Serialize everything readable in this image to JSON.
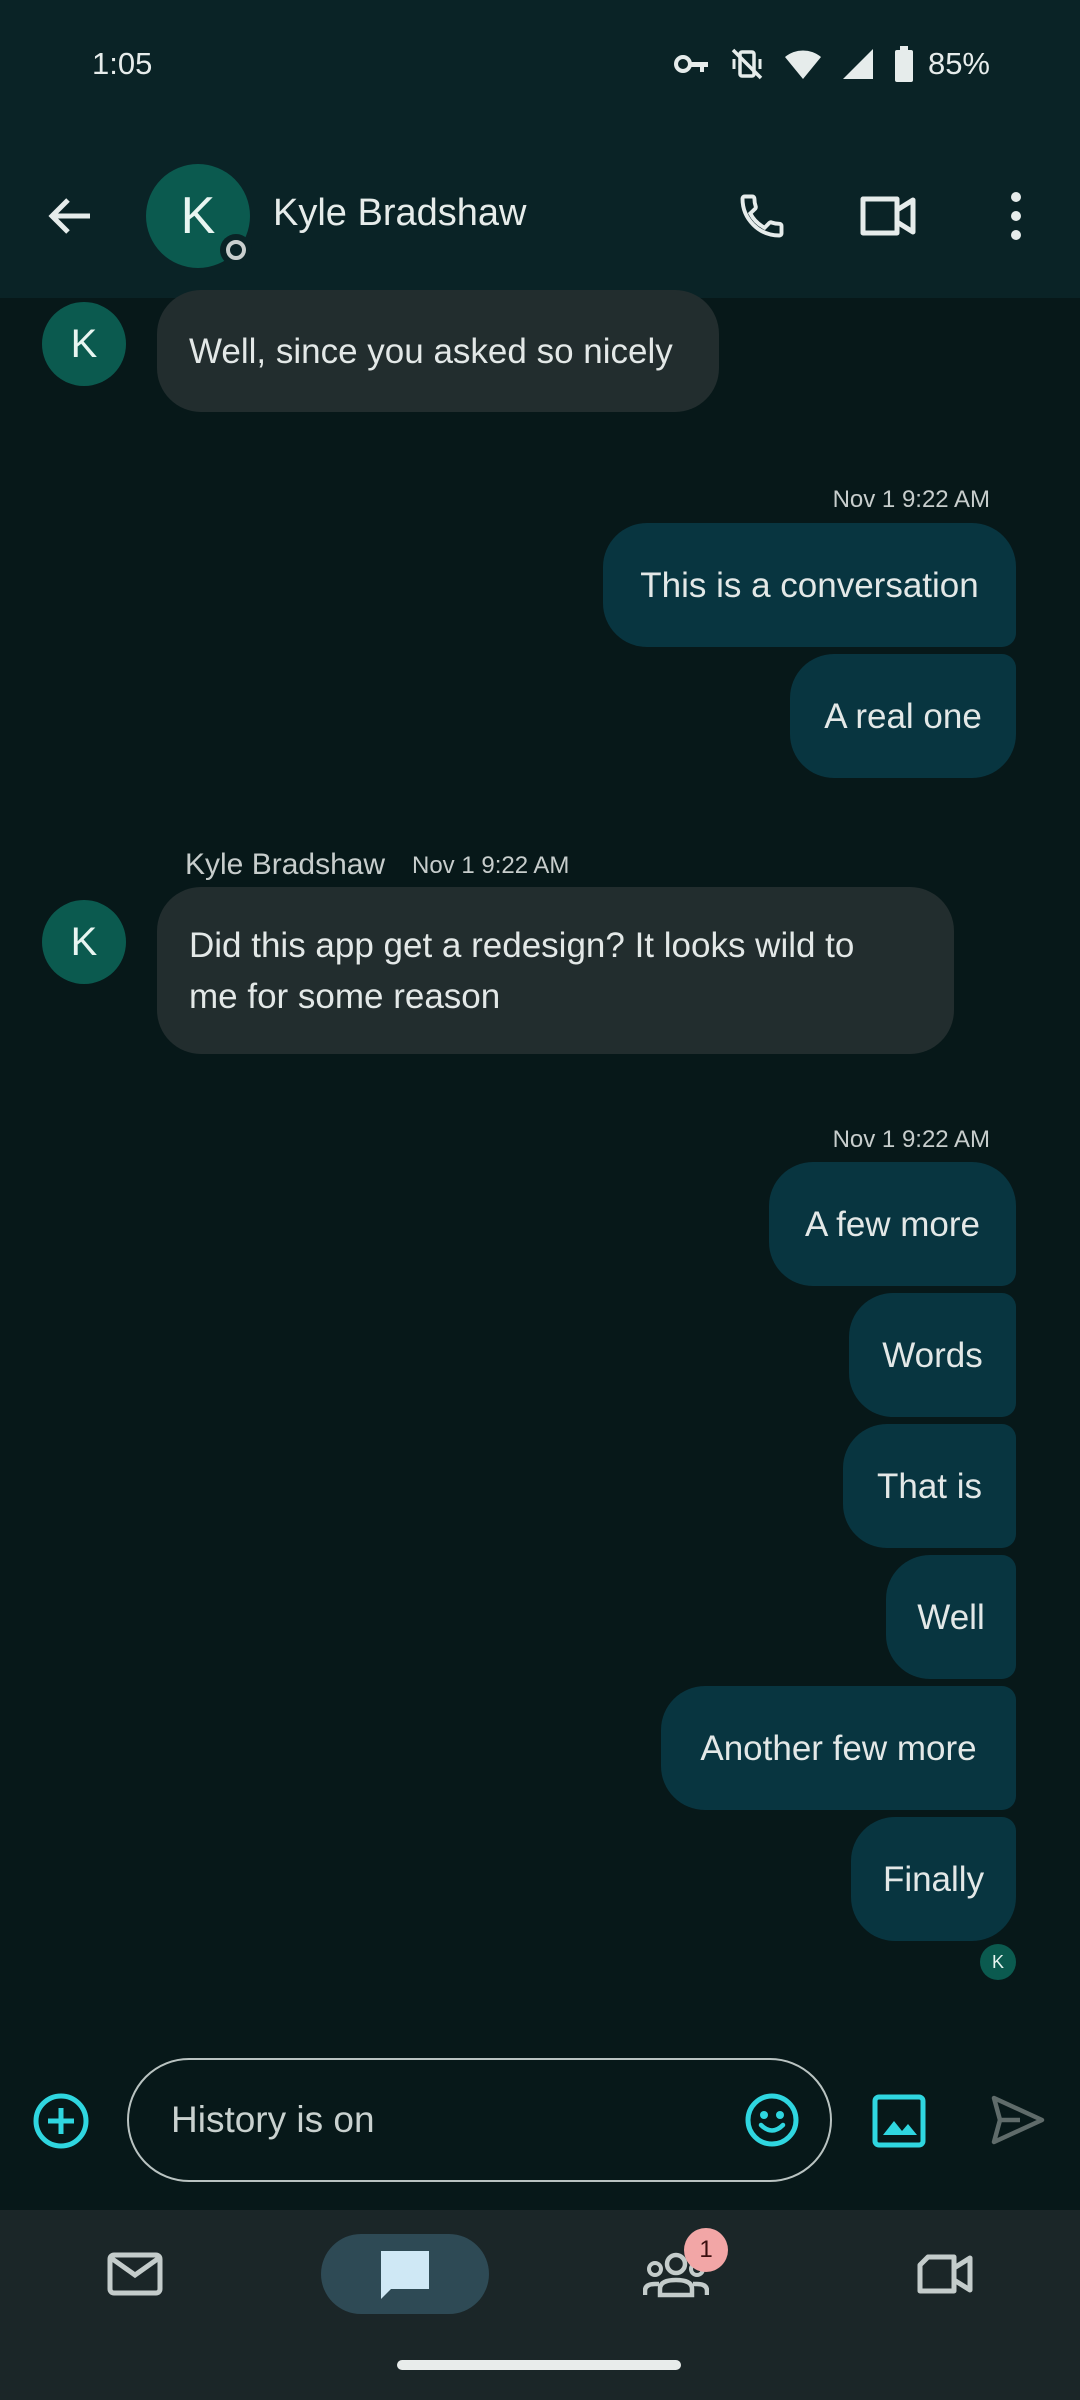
{
  "status_bar": {
    "time": "1:05",
    "battery": "85%",
    "icons": [
      "vpn-key-icon",
      "vibrate-off-icon",
      "wifi-icon",
      "signal-icon",
      "battery-icon"
    ]
  },
  "header": {
    "contact_name": "Kyle Bradshaw",
    "avatar_initial": "K",
    "actions": [
      "phone-icon",
      "video-call-icon",
      "more-vert-icon"
    ]
  },
  "messages": {
    "m1": {
      "text": "Well, since you asked so nicely",
      "direction": "incoming",
      "avatar": "K"
    },
    "ts1": "Nov 1 9:22 AM",
    "m2": {
      "text": "This is a conversation",
      "direction": "outgoing"
    },
    "m3": {
      "text": "A real one",
      "direction": "outgoing"
    },
    "sender2": "Kyle Bradshaw",
    "ts2": "Nov 1 9:22 AM",
    "m4": {
      "line1": "Did this app get a redesign? It looks wild to",
      "line2": "me for some reason",
      "direction": "incoming",
      "avatar": "K"
    },
    "ts3": "Nov 1 9:22 AM",
    "m5": {
      "text": "A few more",
      "direction": "outgoing"
    },
    "m6": {
      "text": "Words",
      "direction": "outgoing"
    },
    "m7": {
      "text": "That is",
      "direction": "outgoing"
    },
    "m8": {
      "text": "Well",
      "direction": "outgoing"
    },
    "m9": {
      "text": "Another few more",
      "direction": "outgoing"
    },
    "m10": {
      "text": "Finally",
      "direction": "outgoing"
    },
    "read_receipt_initial": "K"
  },
  "compose": {
    "placeholder": "History is on"
  },
  "bottom_nav": {
    "items": [
      "mail-icon",
      "chat-icon",
      "spaces-icon",
      "meet-icon"
    ],
    "active": "chat-icon",
    "spaces_badge": "1"
  },
  "colors": {
    "background": "#071819",
    "header": "#0a2326",
    "incoming_bubble": "#222d2e",
    "outgoing_bubble": "#083540",
    "accent": "#2fd6e0",
    "avatar": "#0b5a4f",
    "badge": "#f2a6a6"
  }
}
